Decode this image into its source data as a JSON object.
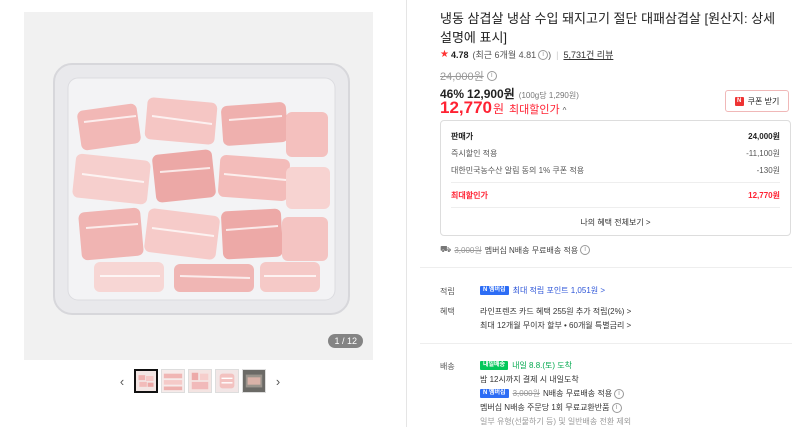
{
  "gallery": {
    "counter": "1 / 12",
    "prev_icon": "chevron-left-icon",
    "next_icon": "chevron-right-icon"
  },
  "product": {
    "title": "냉동 삼겹살 냉삼 수입 돼지고기 절단 대패삼겹살 [원산지: 상세설명에 표시]",
    "rating_score": "4.78",
    "rating_recent": "(최근 6개월 4.81",
    "rating_recent_close": ")",
    "review_count": "5,731건 리뷰",
    "original_price": "24,000원",
    "discount_percent": "46%",
    "sale_price": "12,900원",
    "unit_price": "(100g당 1,290원)",
    "best_price": "12,770",
    "best_price_won": "원",
    "best_price_label": "최대할인가",
    "coupon_badge": "N",
    "coupon_label": "쿠폰 받기"
  },
  "breakdown": {
    "head_label": "판매가",
    "head_value": "24,000원",
    "rows": [
      {
        "label": "즉시할인 적용",
        "value": "-11,100원"
      },
      {
        "label": "대한민국농수산 알림 동의 1% 쿠폰 적용",
        "value": "-130원"
      }
    ],
    "best_label": "최대할인가",
    "best_value": "12,770원",
    "view_all": "나의 혜택 전체보기 >"
  },
  "shipping_summary": {
    "orig": "3,000원",
    "text": "멤버십 N배송 무료배송 적용"
  },
  "points": {
    "label": "적립",
    "badge_n": "N",
    "badge_text": "멤버십",
    "text": "최대 적립 포인트 1,051원 >"
  },
  "benefits": {
    "label": "혜택",
    "line1": "라인프렌즈 카드 혜택 255원 추가 적립(2%) >",
    "line2": "최대 12개월 무이자 할부 • 60개월 특별금리 >"
  },
  "delivery": {
    "label": "배송",
    "badge": "내일배송",
    "arrival": "내일 8.8.(토) 도착",
    "line2": "밤 12시까지 결제 시 내일도착",
    "line3_orig": "3,000원",
    "line3": "N배송 무료배송 적용",
    "line4": "멤버십 N배송 주문당 1회 무료교환반품",
    "line5": "일부 유형(선물하기 등) 및 일반배송 전환 제외"
  },
  "colors": {
    "accent_red": "#f22233",
    "npay_green": "#03c75a"
  }
}
